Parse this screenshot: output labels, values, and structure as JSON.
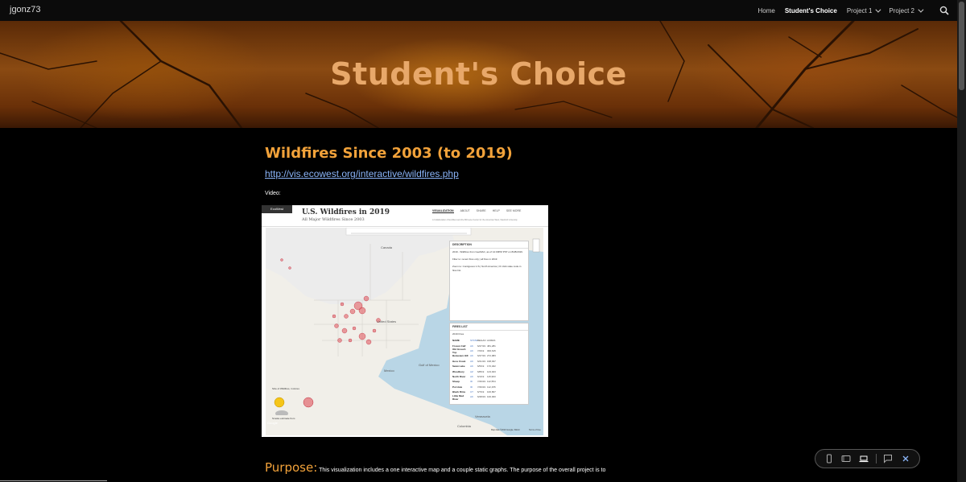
{
  "nav": {
    "site_name": "jgonz73",
    "items": [
      {
        "label": "Home",
        "active": false,
        "has_dropdown": false
      },
      {
        "label": "Student's Choice",
        "active": true,
        "has_dropdown": false
      },
      {
        "label": "Project 1",
        "active": false,
        "has_dropdown": true
      },
      {
        "label": "Project 2",
        "active": false,
        "has_dropdown": true
      }
    ],
    "search_icon": "search-icon"
  },
  "hero": {
    "title": "Student's Choice"
  },
  "main": {
    "heading": "Wildfires Since 2003 (to 2019)",
    "link": "http://vis.ecowest.org/interactive/wildfires.php",
    "video_label": "Video:"
  },
  "video": {
    "brand": "EcoWest",
    "title": "U.S. Wildfires in 2019",
    "subtitle": "All Major Wildfires Since 2003",
    "tabs": [
      "VISUALIZATION",
      "ABOUT",
      "SHARE",
      "HELP",
      "SEE MORE"
    ],
    "credit": "A Collaboration of EcoWest and the Bill Lane Center for the American West, Stanford University",
    "description_title": "DESCRIPTION",
    "description_text": "2019 - Wildfires from GeoMAC, as of 12:00PM PST on 8/28/2019.",
    "filter_text": "Filter to: recent fires only | all fires in 2019",
    "zoom_text": "Zoom to: Contiguous U.S | North America | Or click state code in fires list.",
    "fires_list_title": "FIRES LIST",
    "fires_list_header": "2019 Fires",
    "fires_columns": [
      "NAME",
      "STATE",
      "BEGAN",
      "ACRES"
    ],
    "fires": [
      {
        "name": "Frozen Calf",
        "state": "AK",
        "began": "6/27/19",
        "acres": "481,281"
      },
      {
        "name": "Old Grouch Top",
        "state": "AK",
        "began": "7/2/19",
        "acres": "300,615"
      },
      {
        "name": "Beaveaux Hill",
        "state": "AK",
        "began": "6/27/19",
        "acres": "272,983"
      },
      {
        "name": "Hess Creek",
        "state": "AK",
        "began": "6/21/19",
        "acres": "168,937"
      },
      {
        "name": "Swan Lake",
        "state": "AK",
        "began": "6/5/19",
        "acres": "170,462"
      },
      {
        "name": "Woodbury",
        "state": "AZ",
        "began": "6/8/19",
        "acres": "123,923"
      },
      {
        "name": "North River",
        "state": "AK",
        "began": "6/1/19",
        "acres": "115,963"
      },
      {
        "name": "Sheep",
        "state": "ID",
        "began": "7/26/19",
        "acres": "112,554"
      },
      {
        "name": "Pot Hole",
        "state": "ID",
        "began": "7/26/19",
        "acres": "112,155"
      },
      {
        "name": "Black Rims",
        "state": "UT",
        "began": "6/7/19",
        "acres": "100,807"
      },
      {
        "name": "Little Mud River",
        "state": "AK",
        "began": "6/28/19",
        "acres": "100,000"
      }
    ],
    "legend_title": "Size of Wildfires, in Acres",
    "legend_items": [
      "Started Before",
      "Fires Started",
      "100,000",
      "50,000",
      "10,000"
    ],
    "legend_note": "Smoke estimate from",
    "map_labels": [
      "Canada",
      "United States",
      "Mexico",
      "Gulf of Mexico",
      "Venezuela",
      "Colombia"
    ],
    "map_footer": "Map data ©2019 Google, INEGI",
    "terms": "Terms of Use",
    "google": "Google"
  },
  "purpose": {
    "label": "Purpose:",
    "text": " This visualization includes a one interactive map and a couple static graphs. The purpose of the overall project is to"
  },
  "preview_toolbar": {
    "icons": [
      "phone-icon",
      "tablet-icon",
      "laptop-icon",
      "comment-icon",
      "close-icon"
    ]
  },
  "colors": {
    "accent": "#f2a23a",
    "hero_title": "#e8a86a",
    "link": "#8ab4f8",
    "background": "#000000",
    "fire_marker": "#e0505a"
  }
}
